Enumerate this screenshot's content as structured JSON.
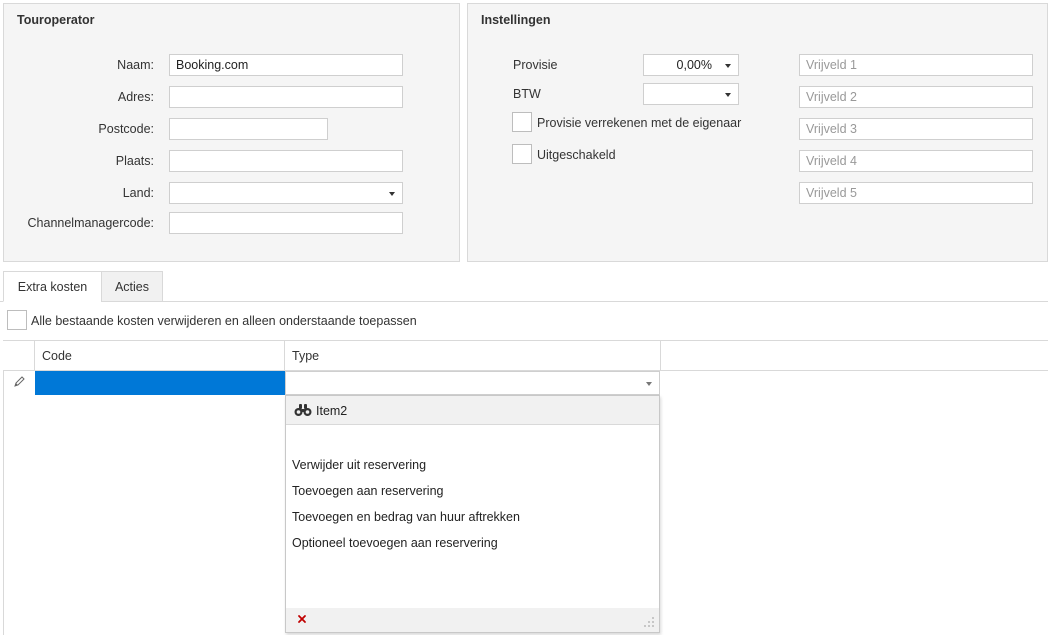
{
  "touroperator": {
    "title": "Touroperator",
    "fields": {
      "naam": {
        "label": "Naam:",
        "value": "Booking.com"
      },
      "adres": {
        "label": "Adres:",
        "value": ""
      },
      "postcode": {
        "label": "Postcode:",
        "value": ""
      },
      "plaats": {
        "label": "Plaats:",
        "value": ""
      },
      "land": {
        "label": "Land:",
        "value": ""
      },
      "channelmanagercode": {
        "label": "Channelmanagercode:",
        "value": ""
      }
    }
  },
  "instellingen": {
    "title": "Instellingen",
    "provisie": {
      "label": "Provisie",
      "value": "0,00%"
    },
    "btw": {
      "label": "BTW",
      "value": ""
    },
    "checkbox_provisie": {
      "label": "Provisie verrekenen met de eigenaar",
      "checked": false
    },
    "checkbox_uitgeschakeld": {
      "label": "Uitgeschakeld",
      "checked": false
    },
    "vrijvelden": [
      "Vrijveld 1",
      "Vrijveld 2",
      "Vrijveld 3",
      "Vrijveld 4",
      "Vrijveld 5"
    ]
  },
  "tabs": [
    {
      "label": "Extra kosten",
      "active": true
    },
    {
      "label": "Acties",
      "active": false
    }
  ],
  "extra_kosten": {
    "checkbox_label": "Alle bestaande kosten verwijderen en alleen onderstaande toepassen",
    "columns": [
      "Code",
      "Type"
    ],
    "editing_row": {
      "code": "",
      "type": ""
    }
  },
  "type_dropdown": {
    "search_text": "Item2",
    "options": [
      "",
      "Verwijder uit reservering",
      "Toevoegen aan reservering",
      "Toevoegen en bedrag van huur aftrekken",
      "Optioneel toevoegen aan reservering"
    ]
  },
  "colors": {
    "selection": "#0078d7",
    "panel_bg": "#f5f5f5",
    "border": "#d9d9d9",
    "clear_icon": "#c00000"
  },
  "icons": {
    "edit_row": "pencil-icon",
    "search": "binoculars-icon",
    "clear": "close-icon",
    "resize": "resize-grip-icon"
  }
}
